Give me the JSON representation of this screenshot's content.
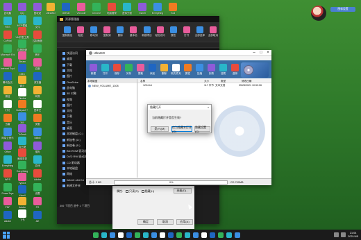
{
  "desktop": {
    "col1": [
      "此电脑",
      "RSS",
      "CoPilot",
      "Microsoft Edge",
      "Internet Explorer",
      "腾讯会议",
      "微信",
      "钉钉",
      "迅雷",
      "网易云音乐",
      "Office",
      "Everything",
      "WPS",
      "PowerToys",
      "PDF",
      "Adobe"
    ],
    "col2": [
      "QQ",
      "MCP模组",
      "XM开发工具",
      "百度网盘",
      "Steam",
      "OBS",
      "微云",
      "Firefox",
      "Notepad++",
      "360",
      "ToDesk",
      "向日葵",
      "美图秀秀",
      "Everything",
      "Typora",
      "Xshell",
      "Adobe",
      "飞书"
    ],
    "col3": [
      "回收站",
      "文件",
      "控制面板",
      "音乐",
      "百度",
      "浏览器",
      "网易",
      "爱奇艺",
      "优酷",
      "Bilibili",
      "搜狗",
      "游戏",
      "Adobe",
      "设置",
      "PS",
      "AE"
    ],
    "top_row": [
      "UltraISO",
      "GitHub",
      "VSCode",
      "Chrome",
      "电脑管家",
      "虚拟光驱",
      "Xshell",
      "Everything",
      "Tool"
    ]
  },
  "ultraiso": {
    "title": "UltraISO",
    "toolbar": [
      "新建",
      "打开",
      "保存",
      "另存",
      "提取",
      "添加",
      "删除",
      "新文件夹",
      "属性",
      "压缩",
      "刻录",
      "挂载",
      "虚拟",
      "转换"
    ],
    "tree_header": "本地磁盘",
    "tree_root": "NEW_VOLUME_1308",
    "columns": [
      "名称",
      "大小",
      "类型",
      "修改日期"
    ],
    "files": [
      {
        "name": "1234.txt",
        "size": "117 字节",
        "type": "文本文档",
        "date": "05/28/2021 10:53:06"
      }
    ],
    "status_left": "总计: 2 KB",
    "status_mid": "0%",
    "status_right": "CD 700MB"
  },
  "dialog": {
    "title": "隐藏打开",
    "message": "当前隐藏打开是否生效?",
    "buttons": [
      "是(Y)(M)",
      "仅为隐藏本打开(O)",
      "隐藏设置(C)"
    ]
  },
  "explorer": {
    "title": "资源管理器",
    "ribbon": [
      "复制路径",
      "粘贴",
      "移动到",
      "复制到",
      "删除",
      "重命名",
      "新建项目",
      "轻松访问",
      "属性",
      "打开",
      "全部选择",
      "全部取消"
    ],
    "sidebar": [
      "快速访问",
      "桌面",
      "下载",
      "文档",
      "图片",
      "OneDrive",
      "此电脑",
      "3D 对象",
      "视频",
      "图片",
      "文档",
      "下载",
      "音乐",
      "桌面",
      "本地磁盘 (C:)",
      "新加卷 (D:)",
      "新加卷 (E:)",
      "BD-ROM 驱动器",
      "DVD RW 驱动器",
      "CD 驱动器",
      "本地磁盘",
      "网络",
      "Win10 x64 Ed",
      "新建文件夹"
    ],
    "status": "306 个项目  选中 1 个项目"
  },
  "props": {
    "row_label": "属性:",
    "checks": [
      "只读(R)",
      "隐藏(H)"
    ],
    "advanced": "高级(D)...",
    "buttons": [
      "确定",
      "取消",
      "应用(A)"
    ]
  },
  "taskbar": {
    "time": "21:04",
    "date": "2021/4/5"
  },
  "widget": {
    "label": "图标设置"
  },
  "colors": {
    "ultra_toolbar": "#3a6ea5",
    "taskbar": "#1b1b1b",
    "dialog_bg": "#f0f0f0",
    "accent": "#0078d7"
  }
}
